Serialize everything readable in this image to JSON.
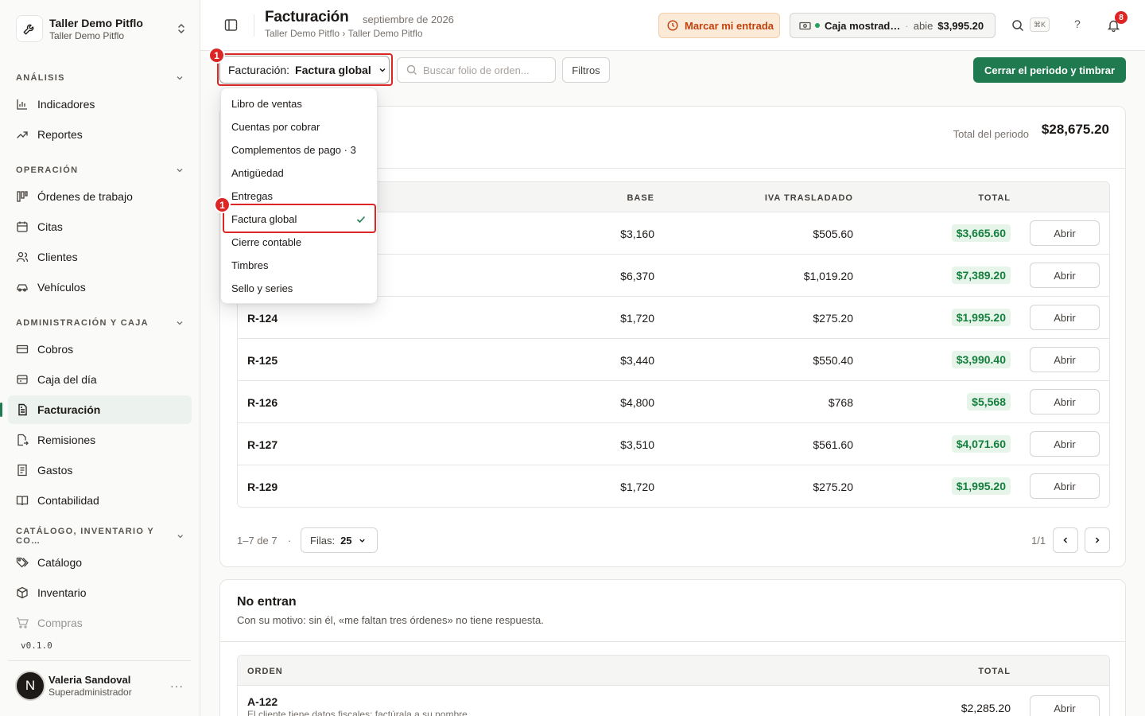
{
  "workspace": {
    "title": "Taller Demo Pitflo",
    "subtitle": "Taller Demo Pitflo"
  },
  "sidebar": {
    "sections": [
      {
        "label": "ANÁLISIS"
      },
      {
        "label": "OPERACIÓN"
      },
      {
        "label": "ADMINISTRACIÓN Y CAJA"
      },
      {
        "label": "CATÁLOGO, INVENTARIO Y CO…"
      }
    ],
    "items": [
      {
        "label": "Indicadores"
      },
      {
        "label": "Reportes"
      },
      {
        "label": "Órdenes de trabajo"
      },
      {
        "label": "Citas"
      },
      {
        "label": "Clientes"
      },
      {
        "label": "Vehículos"
      },
      {
        "label": "Cobros"
      },
      {
        "label": "Caja del día"
      },
      {
        "label": "Facturación"
      },
      {
        "label": "Remisiones"
      },
      {
        "label": "Gastos"
      },
      {
        "label": "Contabilidad"
      },
      {
        "label": "Catálogo"
      },
      {
        "label": "Inventario"
      },
      {
        "label": "Compras"
      }
    ],
    "version": "v0.1.0",
    "user": {
      "initial": "N",
      "name": "Valeria Sandoval",
      "role": "Superadministrador",
      "more": "···"
    }
  },
  "header": {
    "title": "Facturación",
    "date": "septiembre de 2026",
    "breadcrumb": "Taller Demo Pitflo › Taller Demo Pitflo",
    "clock_in": "Marcar mi entrada",
    "cash": {
      "name": "Caja mostrad…",
      "sep": "·",
      "status": "abie",
      "amount": "$3,995.20"
    },
    "shortcut": "⌘K",
    "help": "?",
    "notifications": "8"
  },
  "toolbar": {
    "mode_label": "Facturación:",
    "mode_value": "Factura global",
    "search_placeholder": "Buscar folio de orden...",
    "filters": "Filtros",
    "primary": "Cerrar el periodo y timbrar",
    "marker": "1"
  },
  "dropdown": {
    "items": [
      {
        "label": "Libro de ventas"
      },
      {
        "label": "Cuentas por cobrar"
      },
      {
        "label": "Complementos de pago · 3"
      },
      {
        "label": "Antigüedad"
      },
      {
        "label": "Entregas"
      },
      {
        "label": "Factura global",
        "selected": true
      },
      {
        "label": "Cierre contable"
      },
      {
        "label": "Timbres"
      },
      {
        "label": "Sello y series"
      }
    ],
    "marker": "1"
  },
  "period": {
    "total_label": "Total del periodo",
    "total": "$28,675.20"
  },
  "table": {
    "headers": {
      "base": "BASE",
      "iva": "IVA TRASLADADO",
      "total": "TOTAL"
    },
    "rows": [
      {
        "folio": "",
        "base": "$3,160",
        "iva": "$505.60",
        "total": "$3,665.60",
        "action": "Abrir"
      },
      {
        "folio": "",
        "base": "$6,370",
        "iva": "$1,019.20",
        "total": "$7,389.20",
        "action": "Abrir"
      },
      {
        "folio": "R-124",
        "base": "$1,720",
        "iva": "$275.20",
        "total": "$1,995.20",
        "action": "Abrir"
      },
      {
        "folio": "R-125",
        "base": "$3,440",
        "iva": "$550.40",
        "total": "$3,990.40",
        "action": "Abrir"
      },
      {
        "folio": "R-126",
        "base": "$4,800",
        "iva": "$768",
        "total": "$5,568",
        "action": "Abrir"
      },
      {
        "folio": "R-127",
        "base": "$3,510",
        "iva": "$561.60",
        "total": "$4,071.60",
        "action": "Abrir"
      },
      {
        "folio": "R-129",
        "base": "$1,720",
        "iva": "$275.20",
        "total": "$1,995.20",
        "action": "Abrir"
      }
    ]
  },
  "pagination": {
    "range": "1–7 de 7",
    "dot": "·",
    "rows_label": "Filas:",
    "rows_value": "25",
    "page": "1/1"
  },
  "excluded": {
    "title": "No entran",
    "description": "Con su motivo: sin él, «me faltan tres órdenes» no tiene respuesta.",
    "headers": {
      "order": "ORDEN",
      "total": "TOTAL"
    },
    "rows": [
      {
        "folio": "A-122",
        "note": "El cliente tiene datos fiscales: factúrala a su nombre",
        "total": "$2,285.20",
        "action": "Abrir"
      }
    ]
  },
  "colors": {
    "accent": "#1f7a4f",
    "warning": "#c2410c",
    "highlight": "#dc2626"
  }
}
